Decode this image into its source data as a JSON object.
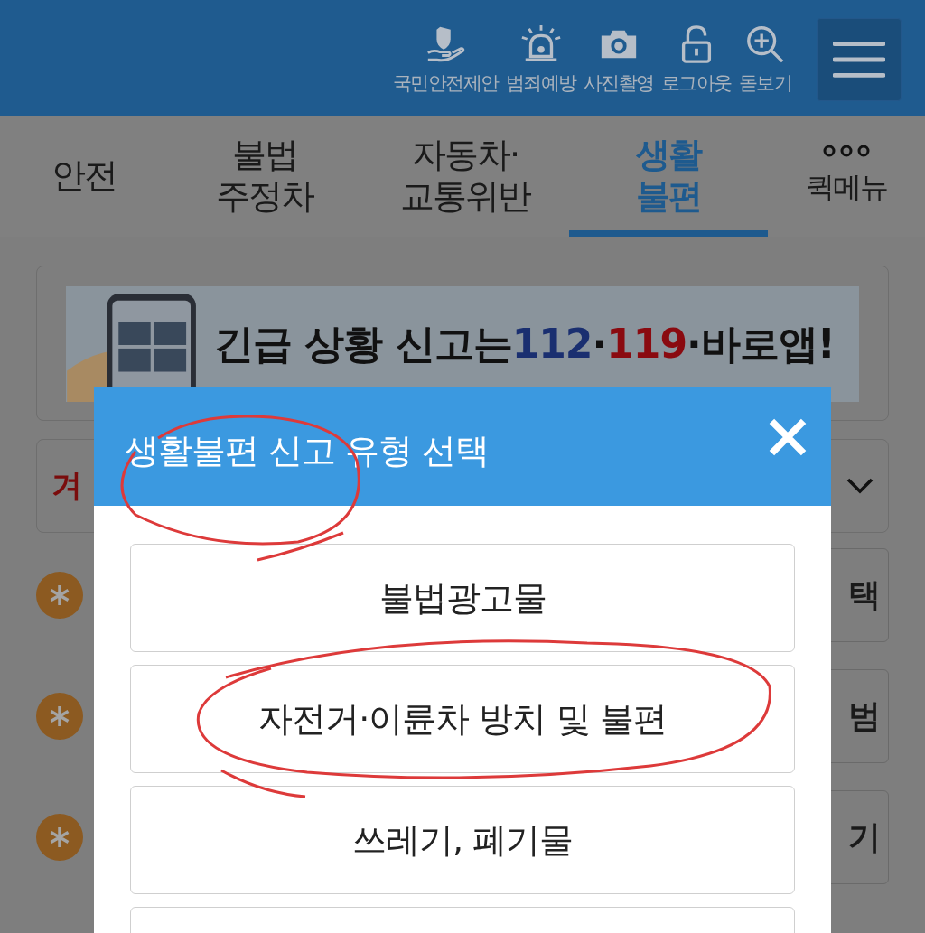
{
  "header": {
    "shortcuts": [
      {
        "kind": "shield-hand",
        "label": "국민안전제안"
      },
      {
        "kind": "siren",
        "label": "범죄예방"
      },
      {
        "kind": "camera",
        "label": "사진촬영"
      },
      {
        "kind": "lock",
        "label": "로그아웃"
      },
      {
        "kind": "zoom",
        "label": "돋보기"
      }
    ]
  },
  "tabs": [
    {
      "label": "안전",
      "selected": false
    },
    {
      "label": "불법\n주정차",
      "selected": false
    },
    {
      "label": "자동차·\n교통위반",
      "selected": false
    },
    {
      "label": "생활\n불편",
      "selected": true
    }
  ],
  "quick_menu": {
    "label": "퀵메뉴"
  },
  "banner": {
    "parts": [
      {
        "text": "긴급 상황 신고는",
        "color": "#111111"
      },
      {
        "text": "112",
        "color": "#1a2f70"
      },
      {
        "text": "·",
        "color": "#111111"
      },
      {
        "text": "119",
        "color": "#8a0a10"
      },
      {
        "text": "·바로앱!",
        "color": "#111111"
      }
    ]
  },
  "notice": {
    "text": "겨"
  },
  "rows": [
    {
      "button": "택"
    },
    {
      "button": "범"
    },
    {
      "button": "기"
    }
  ],
  "modal": {
    "title": "생활불편 신고 유형 선택",
    "options": [
      {
        "label": "불법광고물"
      },
      {
        "label": "자전거·이륜차 방치 및 불편"
      },
      {
        "label": "쓰레기, 폐기물"
      }
    ]
  }
}
